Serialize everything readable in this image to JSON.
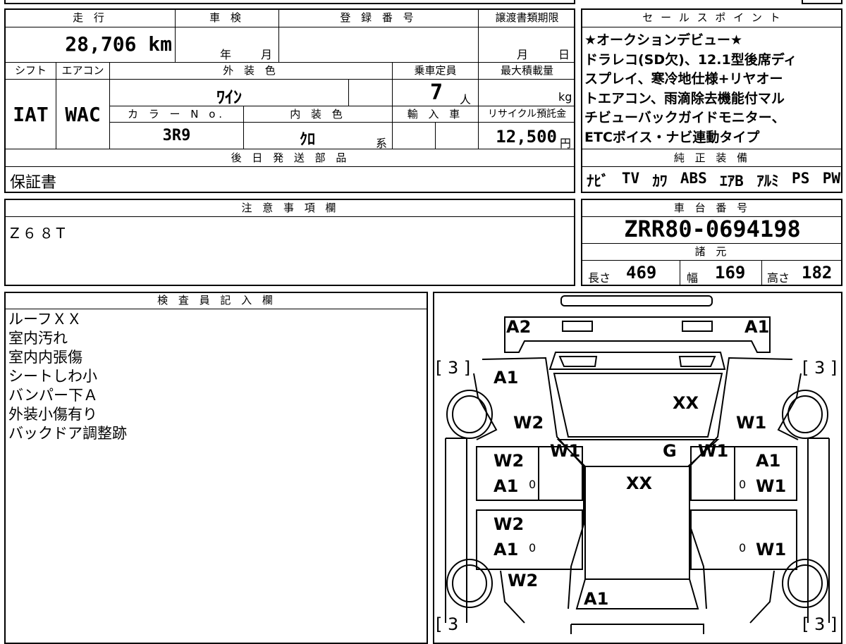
{
  "top_headers": {
    "mileage": "走 行",
    "shaken": "車 検",
    "registration_no": "登 録 番 号",
    "transfer_deadline": "譲渡書類期限",
    "sales_point": "セ ー ル ス ポ イ ン ト"
  },
  "mileage_value": "28,706 km",
  "shaken_year": "年",
  "shaken_month": "月",
  "deadline_month": "月",
  "deadline_day": "日",
  "row2_headers": {
    "shift": "シフト",
    "aircon": "エアコン",
    "exterior_color": "外 装 色",
    "capacity": "乗車定員",
    "max_load": "最大積載量"
  },
  "shift_value": "IAT",
  "aircon_value": "WAC",
  "exterior_color_value": "ﾜｲﾝ",
  "capacity_value": "7",
  "capacity_unit": "人",
  "load_unit": "kg",
  "row3_headers": {
    "color_no": "カ ラ ー N o.",
    "interior_color": "内 装 色",
    "import": "輸 入 車",
    "recycle": "リサイクル預託金"
  },
  "color_no_value": "3R9",
  "interior_color_value": "ｸﾛ",
  "interior_suffix": "系",
  "recycle_value": "12,500",
  "recycle_unit": "円",
  "sales_point_lines": [
    "★オークションデビュー★",
    "ドラレコ(SD欠)、12.1型後席ディ",
    "スプレイ、寒冷地仕様+リヤオー",
    "トエアコン、雨滴除去機能付マル",
    "チビューバックガイドモニター、",
    "ETCボイス・ナビ連動タイプ"
  ],
  "later_parts_header": "後 日 発 送 部 品",
  "later_parts_value": "保証書",
  "genuine_header": "純 正 装 備",
  "genuine_items": [
    "ﾅﾋﾞ",
    "TV",
    "ｶﾜ",
    "ABS",
    "ｴｱB",
    "ｱﾙﾐ",
    "PS",
    "PW"
  ],
  "notes_header": "注 意 事 項 欄",
  "notes_value": "Z６８T",
  "chassis_header": "車 台 番 号",
  "chassis_value": "ZRR80-0694198",
  "specs_header": "諸 元",
  "specs": {
    "length_label": "長さ",
    "length_value": "469",
    "width_label": "幅",
    "width_value": "169",
    "height_label": "高さ",
    "height_value": "182"
  },
  "inspector_header": "検 査 員 記 入 欄",
  "inspector_lines": [
    "ルーフＸＸ",
    "室内汚れ",
    "室内内張傷",
    "シートしわ小",
    "バンパー下Ａ",
    "外装小傷有り",
    "バックドア調整跡"
  ],
  "diagram_marks": {
    "a2_top": "A2",
    "a1_top": "A1",
    "tire_fl": "[ 3 ]",
    "tire_fr": "[ 3 ]",
    "tire_rl": "[ 3",
    "tire_rr": "[ 3 ]",
    "a1_fl": "A1",
    "w2_fl": "W2",
    "xx_hood": "XX",
    "w1_fr": "W1",
    "w1_lpillar": "W1",
    "g_glass": "G",
    "w1_rpillar": "W1",
    "w2_ld1": "W2",
    "a1_ld1": "A1",
    "zero_ld1": "0",
    "xx_roof": "XX",
    "a1_rd1": "A1",
    "zero_rd1": "0",
    "w1_rd1": "W1",
    "w2_ld2": "W2",
    "a1_ld2": "A1",
    "zero_ld2": "0",
    "zero_rd2": "0",
    "w1_rd2": "W1",
    "w2_rl": "W2",
    "a1_rear": "A1"
  }
}
